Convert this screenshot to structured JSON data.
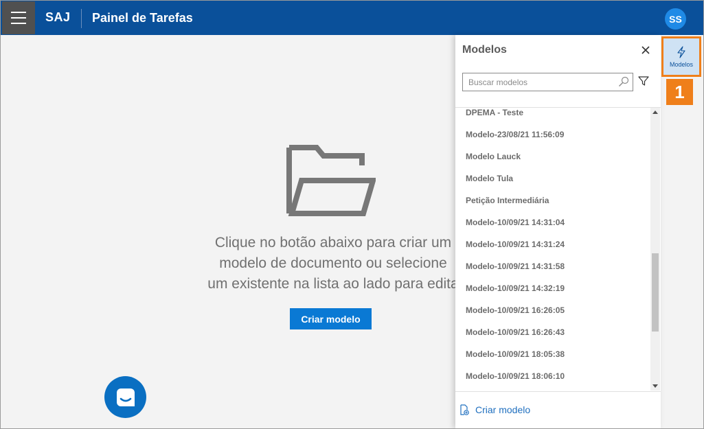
{
  "header": {
    "brand": "SAJ",
    "title": "Painel de Tarefas",
    "user_initials": "SS"
  },
  "main": {
    "empty_message_lines": [
      "Clique no botão abaixo para criar um",
      "modelo de documento ou selecione",
      "um existente na lista ao lado para edita"
    ],
    "create_button_label": "Criar modelo"
  },
  "panel": {
    "title": "Modelos",
    "search_placeholder": "Buscar modelos",
    "items": [
      "DPEMA - Teste",
      "Modelo-23/08/21 11:56:09",
      "Modelo Lauck",
      "Modelo Tula",
      "Petição Intermediária",
      "Modelo-10/09/21 14:31:04",
      "Modelo-10/09/21 14:31:24",
      "Modelo-10/09/21 14:31:58",
      "Modelo-10/09/21 14:32:19",
      "Modelo-10/09/21 16:26:05",
      "Modelo-10/09/21 16:26:43",
      "Modelo-10/09/21 18:05:38",
      "Modelo-10/09/21 18:06:10"
    ],
    "footer_link_label": "Criar modelo"
  },
  "rail": {
    "modelos_label": "Modelos",
    "callout_number": "1"
  },
  "icons": {
    "menu": "hamburger-icon",
    "folder": "open-folder-icon",
    "chat": "chat-icon",
    "close": "close-icon",
    "search": "search-icon",
    "filter": "filter-icon",
    "new_document": "new-document-icon",
    "lightning": "lightning-icon"
  },
  "colors": {
    "topbar": "#0a509a",
    "accent": "#0a79d4",
    "callout": "#ef7f1a"
  }
}
